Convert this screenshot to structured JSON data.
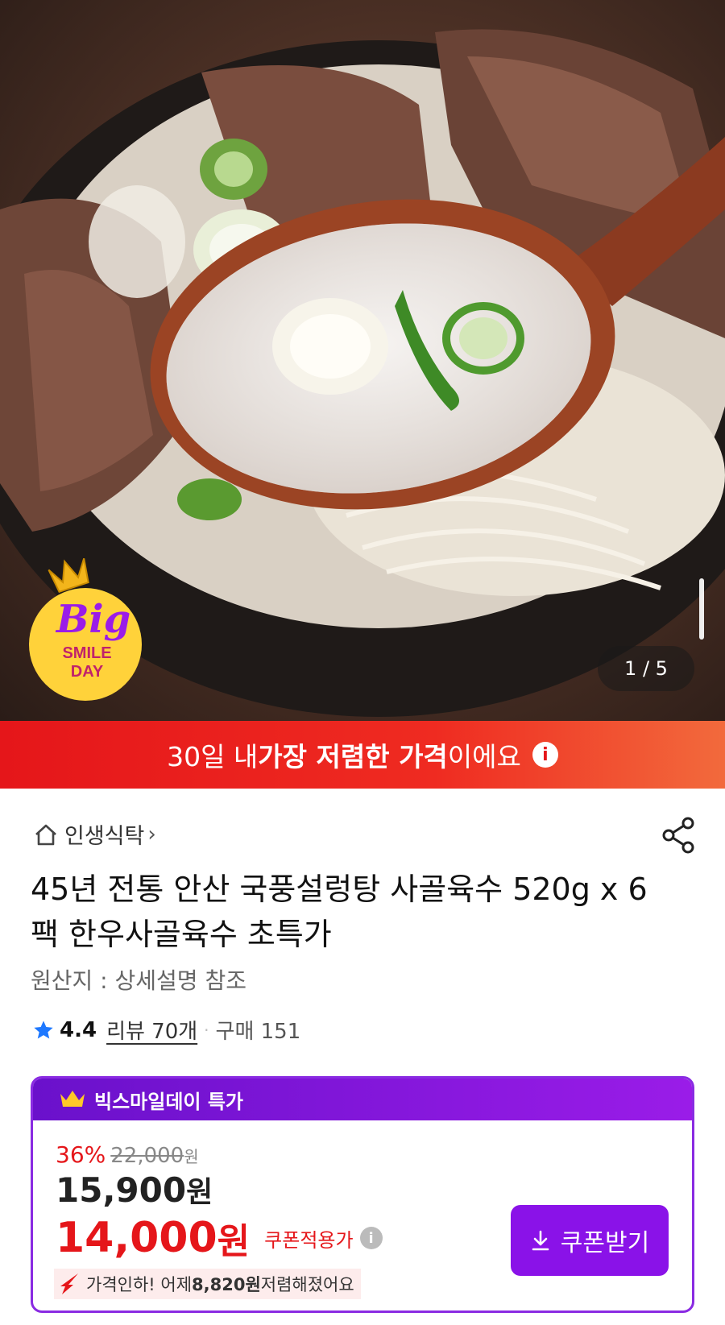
{
  "hero": {
    "counter": "1 / 5",
    "badge": {
      "big": "Big",
      "line1": "SMILE",
      "line2": "DAY"
    }
  },
  "banner": {
    "prefix": "30일 내 ",
    "highlight": "가장 저렴한 가격",
    "suffix": "이에요",
    "info": "i"
  },
  "store": {
    "name": "인생식탁",
    "chevron": "›"
  },
  "product": {
    "title": "45년 전통 안산 국풍설렁탕 사골육수 520g x 6팩 한우사골육수 초특가",
    "origin": "원산지 : 상세설명 참조",
    "rating": "4.4",
    "review": "리뷰 70개",
    "separator": "·",
    "purchases": "구매 151"
  },
  "deal": {
    "header": "빅스마일데이 특가",
    "discount_pct": "36%",
    "original_price": "22,000",
    "original_unit": "원",
    "sale_price": "15,900",
    "sale_unit": "원",
    "coupon_price": "14,000",
    "coupon_unit": "원",
    "coupon_label": "쿠폰적용가",
    "info": "i",
    "drop_prefix": "가격인하! 어제 ",
    "drop_amount": "8,820원",
    "drop_suffix": " 저렴해졌어요",
    "coupon_button": "쿠폰받기"
  },
  "colors": {
    "accent_red": "#e5161a",
    "accent_purple": "#8a12e8"
  }
}
